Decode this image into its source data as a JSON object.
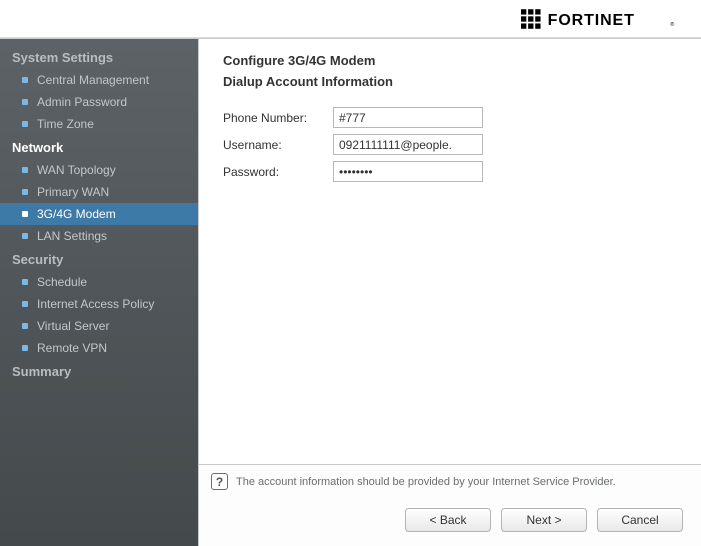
{
  "brand": "FORTINET",
  "sidebar": {
    "groups": [
      {
        "title": "System Settings",
        "items": [
          {
            "label": "Central Management",
            "active": false
          },
          {
            "label": "Admin Password",
            "active": false
          },
          {
            "label": "Time Zone",
            "active": false
          }
        ]
      },
      {
        "title": "Network",
        "items": [
          {
            "label": "WAN Topology",
            "active": false
          },
          {
            "label": "Primary WAN",
            "active": false
          },
          {
            "label": "3G/4G Modem",
            "active": true
          },
          {
            "label": "LAN Settings",
            "active": false
          }
        ]
      },
      {
        "title": "Security",
        "items": [
          {
            "label": "Schedule",
            "active": false
          },
          {
            "label": "Internet Access Policy",
            "active": false
          },
          {
            "label": "Virtual Server",
            "active": false
          },
          {
            "label": "Remote VPN",
            "active": false
          }
        ]
      },
      {
        "title": "Summary",
        "items": []
      }
    ]
  },
  "main": {
    "title": "Configure 3G/4G Modem",
    "subtitle": "Dialup Account Information",
    "fields": {
      "phone": {
        "label": "Phone Number:",
        "value": "#777"
      },
      "username": {
        "label": "Username:",
        "value": "0921111111@people."
      },
      "password": {
        "label": "Password:",
        "value": "••••••••"
      }
    },
    "hint": "The account information should be provided by your Internet Service Provider."
  },
  "footer": {
    "back": "< Back",
    "next": "Next >",
    "cancel": "Cancel"
  }
}
